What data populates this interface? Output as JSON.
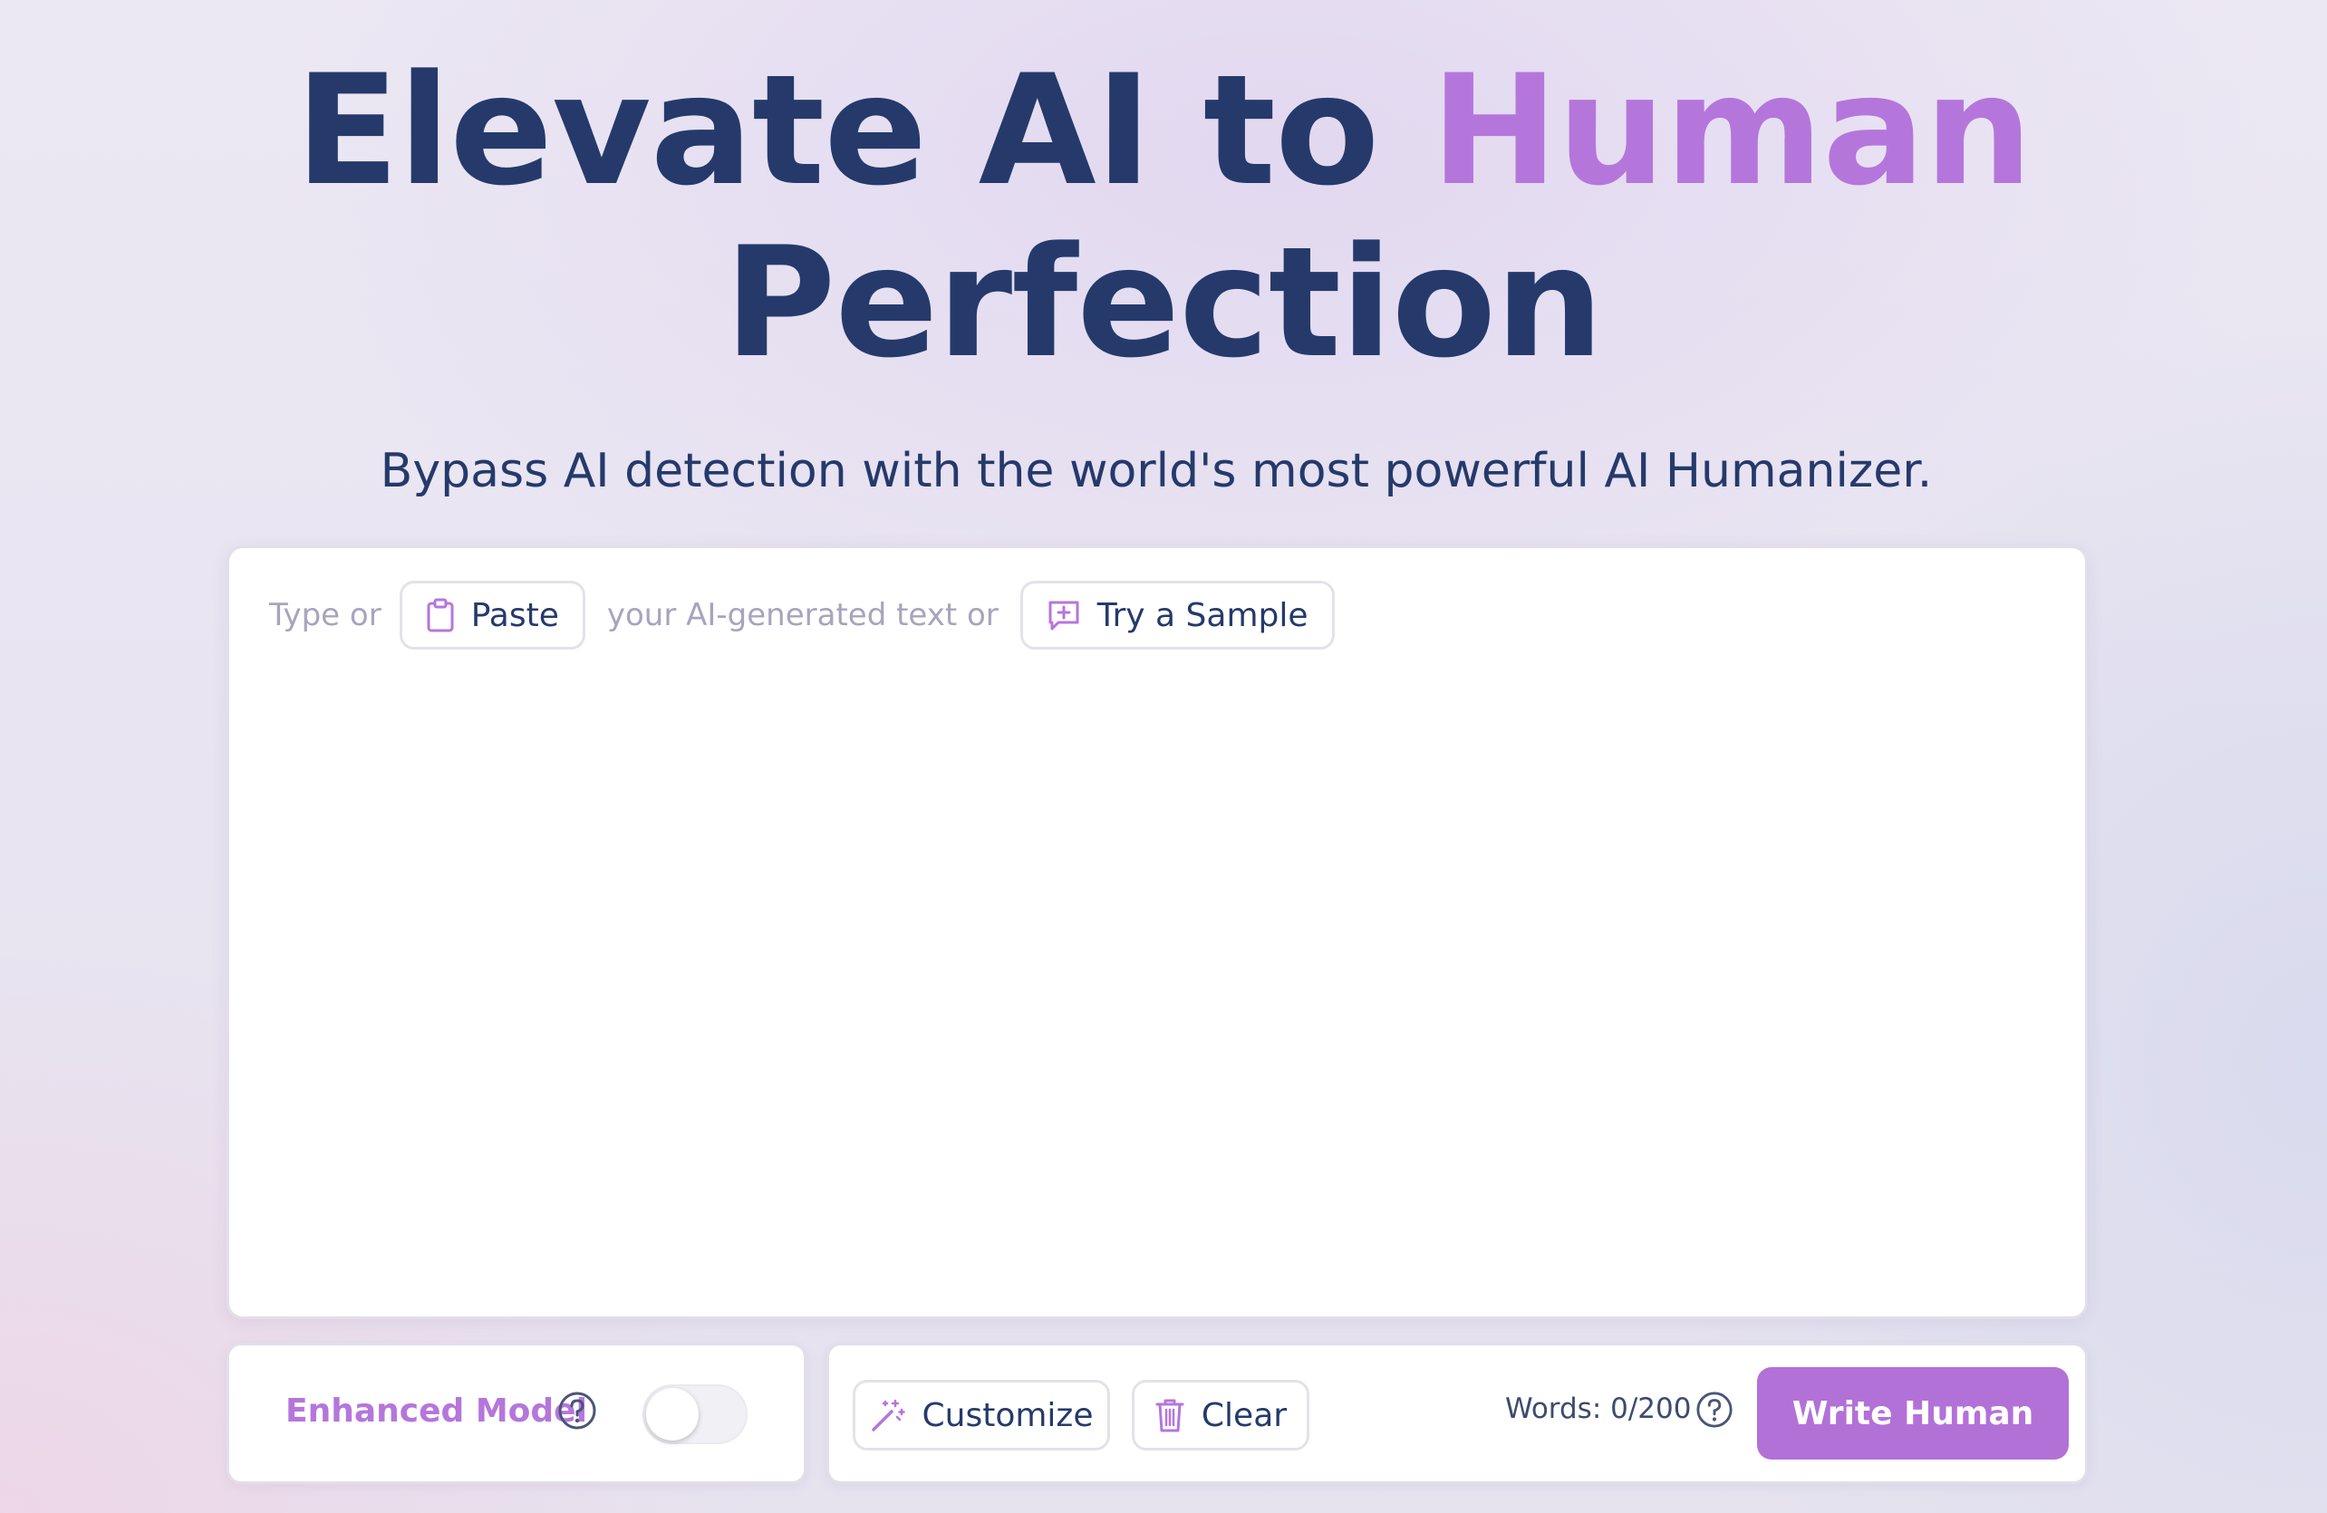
{
  "headline": {
    "line1_prefix": "Elevate AI to",
    "line1_accent": "Human",
    "line2": "Perfection"
  },
  "subtitle": "Bypass AI detection with the world's most powerful AI Humanizer.",
  "editor": {
    "prompt_prefix": "Type or",
    "paste_label": "Paste",
    "prompt_middle": "your AI-generated text or",
    "sample_label": "Try a Sample",
    "text_value": ""
  },
  "options": {
    "enhanced_model_label": "Enhanced Model",
    "enhanced_model_on": false
  },
  "actions": {
    "customize_label": "Customize",
    "clear_label": "Clear",
    "word_count": "Words: 0/200",
    "write_human_label": "Write Human"
  },
  "colors": {
    "primary_text": "#253a6b",
    "accent": "#b576db",
    "button": "#b271d7"
  },
  "icons": {
    "paste": "clipboard-icon",
    "sample": "chat-sparkle-icon",
    "enhanced_help": "question-circle-icon",
    "customize": "magic-wand-icon",
    "clear": "trash-icon",
    "word_help": "question-circle-icon"
  }
}
